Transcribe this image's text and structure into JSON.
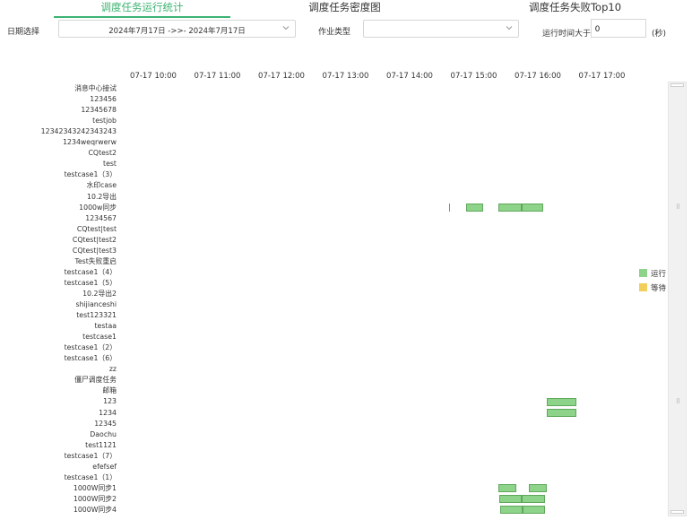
{
  "tabs": [
    {
      "label": "调度任务运行统计",
      "active": true
    },
    {
      "label": "调度任务密度图",
      "active": false
    },
    {
      "label": "调度任务失败Top10",
      "active": false
    }
  ],
  "filters": {
    "date_label": "日期选择",
    "date_value": "2024年7月17日 ->>- 2024年7月17日",
    "job_type_label": "作业类型",
    "job_type_value": "",
    "runtime_label": "运行时间大于",
    "runtime_value": "0",
    "runtime_unit": "(秒)"
  },
  "legend": [
    {
      "label": "运行",
      "color": "#8ed38a"
    },
    {
      "label": "等待",
      "color": "#f2cf5b"
    }
  ],
  "chart_data": {
    "type": "gantt",
    "x_ticks": [
      "07-17 10:00",
      "07-17 11:00",
      "07-17 12:00",
      "07-17 13:00",
      "07-17 14:00",
      "07-17 15:00",
      "07-17 16:00",
      "07-17 17:00"
    ],
    "x_range": [
      "07-17 09:45",
      "07-17 17:30"
    ],
    "categories": [
      "消息中心接试",
      "123456",
      "12345678",
      "testjob",
      "12342343242343243",
      "1234weqrwerw",
      "CQtest2",
      "test",
      "testcase1（3）",
      "水印case",
      "10.2导出",
      "1000w同步",
      "1234567",
      "CQtest|test",
      "CQtest|test2",
      "CQtest|test3",
      "Test失败重启",
      "testcase1（4）",
      "testcase1（5）",
      "10.2导出2",
      "shijianceshi",
      "test123321",
      "testaa",
      "testcase1",
      "testcase1（2）",
      "testcase1（6）",
      "zz",
      "僵尸调度任务",
      "邮箱",
      "123",
      "1234",
      "12345",
      "Daochu",
      "test1121",
      "testcase1（7）",
      "efefsef",
      "testcase1（1）",
      "1000W同步1",
      "1000W同步2",
      "1000W同步4"
    ],
    "series": [
      {
        "name": "运行",
        "tasks": [
          {
            "category": "1000w同步",
            "start": "14:37",
            "end": "14:38"
          },
          {
            "category": "1000w同步",
            "start": "14:53",
            "end": "15:09"
          },
          {
            "category": "1000w同步",
            "start": "15:23",
            "end": "15:45"
          },
          {
            "category": "1000w同步",
            "start": "15:45",
            "end": "16:05"
          },
          {
            "category": "123",
            "start": "16:08",
            "end": "16:36"
          },
          {
            "category": "1234",
            "start": "16:08",
            "end": "16:36"
          },
          {
            "category": "1000W同步1",
            "start": "15:23",
            "end": "15:40"
          },
          {
            "category": "1000W同步1",
            "start": "15:52",
            "end": "16:08"
          },
          {
            "category": "1000W同步2",
            "start": "15:24",
            "end": "15:45"
          },
          {
            "category": "1000W同步2",
            "start": "15:45",
            "end": "16:07"
          },
          {
            "category": "1000W同步4",
            "start": "15:25",
            "end": "15:46"
          },
          {
            "category": "1000W同步4",
            "start": "15:46",
            "end": "16:07"
          }
        ]
      },
      {
        "name": "等待",
        "tasks": []
      }
    ]
  }
}
